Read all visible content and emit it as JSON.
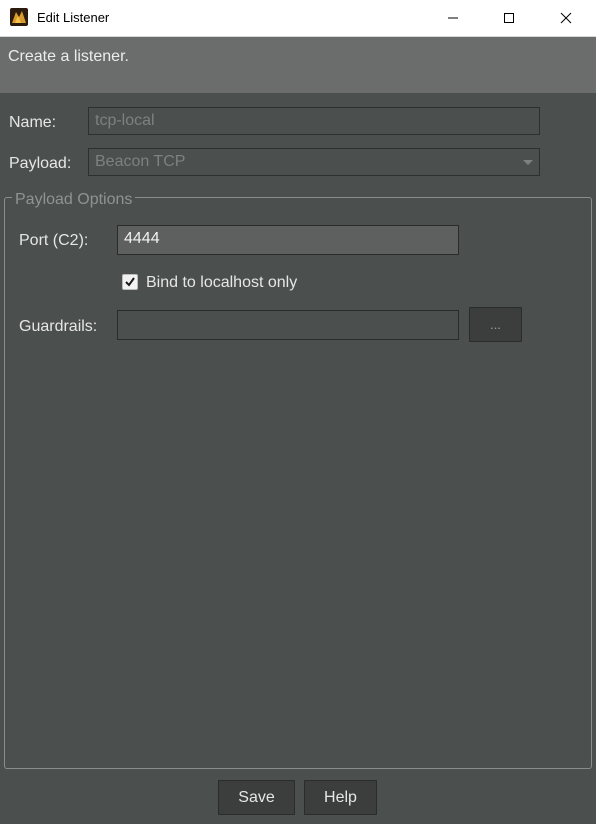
{
  "window": {
    "title": "Edit Listener"
  },
  "banner": {
    "text": "Create a listener."
  },
  "form": {
    "name_label": "Name:",
    "name_value": "tcp-local",
    "payload_label": "Payload:",
    "payload_value": "Beacon TCP"
  },
  "payload_options": {
    "legend": "Payload Options",
    "port_label": "Port (C2):",
    "port_value": "4444",
    "bind_label": "Bind to localhost only",
    "bind_checked": true,
    "guardrails_label": "Guardrails:",
    "guardrails_value": "",
    "browse_label": "..."
  },
  "buttons": {
    "save": "Save",
    "help": "Help"
  },
  "icons": [
    "app-icon",
    "minimize-icon",
    "maximize-icon",
    "close-icon",
    "checkmark-icon",
    "chevron-down-icon"
  ]
}
